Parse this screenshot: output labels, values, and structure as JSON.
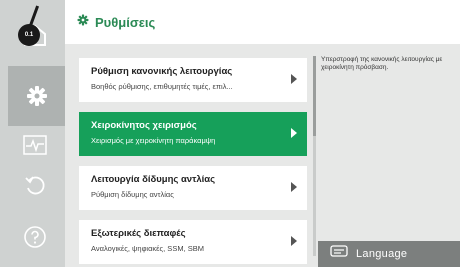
{
  "header": {
    "title": "Ρυθμίσεις",
    "accent": "#2b8a55"
  },
  "rail": {
    "items": [
      {
        "name": "home",
        "icon": "home-icon"
      },
      {
        "name": "settings",
        "icon": "gear-icon",
        "active": true
      },
      {
        "name": "diagnostics",
        "icon": "pulse-icon"
      },
      {
        "name": "restore",
        "icon": "undo-icon"
      },
      {
        "name": "help",
        "icon": "question-icon"
      }
    ],
    "pointer_label": "0.1"
  },
  "menu": {
    "items": [
      {
        "title": "Ρύθμιση κανονικής λειτουργίας",
        "subtitle": "Βοηθός ρύθμισης, επιθυμητές τιμές, επιλ...",
        "selected": false
      },
      {
        "title": "Χειροκίνητος χειρισμός",
        "subtitle": "Χειρισμός με χειροκίνητη παράκαμψη",
        "selected": true
      },
      {
        "title": "Λειτουργία δίδυμης αντλίας",
        "subtitle": "Ρύθμιση δίδυμης αντλίας",
        "selected": false
      },
      {
        "title": "Εξωτερικές διεπαφές",
        "subtitle": "Αναλογικές, ψηφιακές, SSM, SBM",
        "selected": false
      }
    ]
  },
  "help": {
    "text": "Υπερστροφή της κανονικής λειτουργίας με χειροκίνητη πρόσβαση."
  },
  "language_button": {
    "label": "Language"
  },
  "colors": {
    "selected": "#16a05a",
    "panel": "#e7e8e7",
    "rail": "#cfd2d1",
    "language_button": "#7c7f7e"
  }
}
